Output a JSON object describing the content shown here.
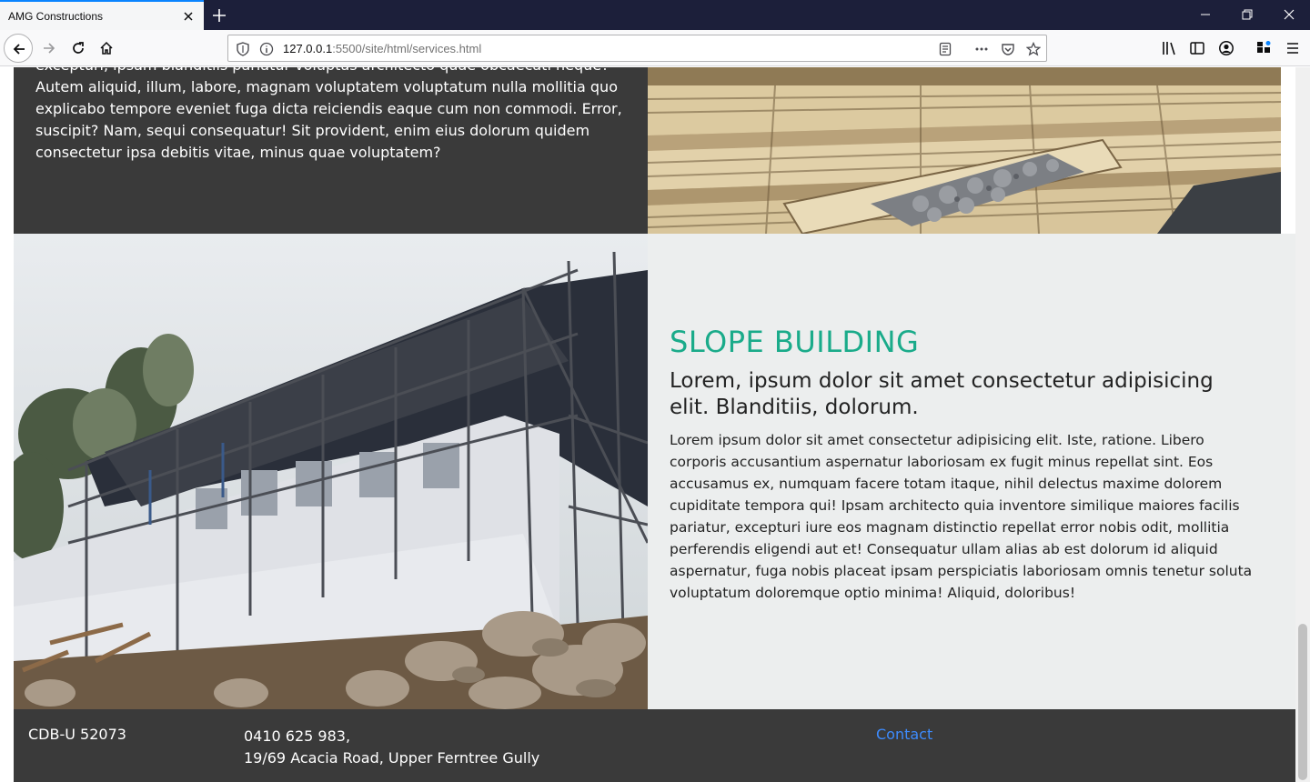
{
  "browser": {
    "tab_title": "AMG Constructions",
    "url_host": "127.0.0.1",
    "url_path": ":5500/site/html/services.html"
  },
  "intro_service": {
    "body": "excepturi, ipsam blanditiis pariatur voluptas architecto quae obcaecati neque? Autem aliquid, illum, labore, magnam voluptatem voluptatum nulla mollitia quo explicabo tempore eveniet fuga dicta reiciendis eaque cum non commodi. Error, suscipit? Nam, sequi consequatur! Sit provident, enim eius dolorum quidem consectetur ipsa debitis vitae, minus quae voluptatem?"
  },
  "slope_service": {
    "title": "SLOPE BUILDING",
    "subtitle": "Lorem, ipsum dolor sit amet consectetur adipisicing elit. Blanditiis, dolorum.",
    "body": "Lorem ipsum dolor sit amet consectetur adipisicing elit. Iste, ratione. Libero corporis accusantium aspernatur laboriosam ex fugit minus repellat sint. Eos accusamus ex, numquam facere totam itaque, nihil delectus maxime dolorem cupiditate tempora qui! Ipsam architecto quia inventore similique maiores facilis pariatur, excepturi iure eos magnam distinctio repellat error nobis odit, mollitia perferendis eligendi aut et! Consequatur ullam alias ab est dolorum id aliquid aspernatur, fuga nobis placeat ipsam perspiciatis laboriosam omnis tenetur soluta voluptatum doloremque optio minima! Aliquid, doloribus!"
  },
  "footer": {
    "license": "CDB-U 52073",
    "phone": "0410 625 983,",
    "address": "19/69 Acacia Road, Upper Ferntree Gully",
    "contact_label": "Contact"
  },
  "colors": {
    "accent": "#1aab8a",
    "dark_panel": "#3a3a3a",
    "light_panel": "#eceeee",
    "link": "#3d8bfd"
  },
  "icons": {
    "back": "arrow-left-icon",
    "forward": "arrow-right-icon",
    "reload": "reload-icon",
    "home": "home-icon"
  }
}
